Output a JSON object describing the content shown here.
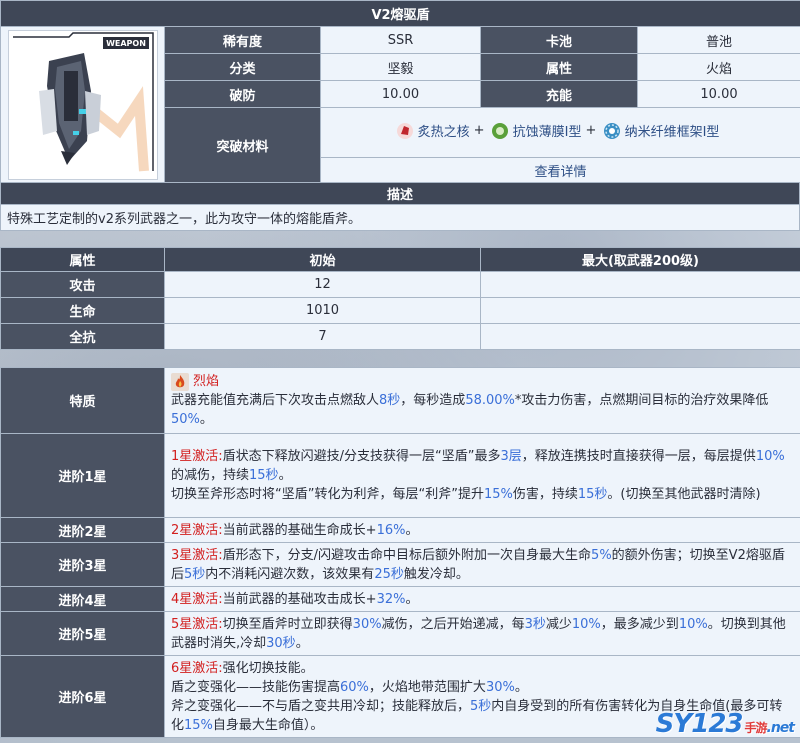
{
  "weapon": {
    "title": "V2熔驱盾",
    "badge": "WEAPON",
    "rarity_label": "稀有度",
    "rarity": "SSR",
    "pool_label": "卡池",
    "pool": "普池",
    "class_label": "分类",
    "class": "坚毅",
    "attr_label": "属性",
    "attr": "火焰",
    "break_label": "破防",
    "break": "10.00",
    "charge_label": "充能",
    "charge": "10.00",
    "breakthrough_label": "突破材料",
    "materials": [
      {
        "name": "炙热之核",
        "sep": "+",
        "icon": "red-crystal-icon",
        "color": "#c0262d"
      },
      {
        "name": "抗蚀薄膜Ⅰ型",
        "sep": "+",
        "icon": "green-film-icon",
        "color": "#5aa03a"
      },
      {
        "name": "纳米纤维框架Ⅰ型",
        "sep": "",
        "icon": "blue-frame-icon",
        "color": "#3a8fc4"
      }
    ],
    "details_link": "查看详情"
  },
  "description": {
    "header": "描述",
    "text": "特殊工艺定制的v2系列武器之一，此为攻守一体的熔能盾斧。"
  },
  "stats": {
    "headers": [
      "属性",
      "初始",
      "最大(取武器200级)"
    ],
    "rows": [
      {
        "label": "攻击",
        "init": "12",
        "max": ""
      },
      {
        "label": "生命",
        "init": "1010",
        "max": ""
      },
      {
        "label": "全抗",
        "init": "7",
        "max": ""
      }
    ]
  },
  "trait": {
    "label": "特质",
    "name": "烈焰",
    "icon": "flame-icon",
    "p1": "武器充能值充满后下次攻击点燃敌人",
    "sec": "8秒",
    "p2": "，每秒造成",
    "pct": "58.00%",
    "p3": "*攻击力伤害，点燃期间目标的治疗效果降低",
    "heal": "50%",
    "p4": "。"
  },
  "advance": [
    {
      "label": "进阶1星",
      "lines": [
        [
          {
            "t": "1星激活:",
            "c": "red"
          },
          {
            "t": "盾状态下释放闪避技/分支技获得一层“坚盾”最多"
          },
          {
            "t": "3层",
            "c": "blue"
          },
          {
            "t": "，释放连携技时直接获得一层，每层提供"
          },
          {
            "t": "10%",
            "c": "blue"
          },
          {
            "t": "的减伤，持续"
          },
          {
            "t": "15秒",
            "c": "blue"
          },
          {
            "t": "。"
          }
        ],
        [
          {
            "t": "切换至斧形态时将“坚盾”转化为利斧，每层“利斧”提升"
          },
          {
            "t": "15%",
            "c": "blue"
          },
          {
            "t": "伤害，持续"
          },
          {
            "t": "15秒",
            "c": "blue"
          },
          {
            "t": "。(切换至其他武器时清除)"
          }
        ]
      ]
    },
    {
      "label": "进阶2星",
      "lines": [
        [
          {
            "t": "2星激活:",
            "c": "red"
          },
          {
            "t": "当前武器的基础生命成长+"
          },
          {
            "t": "16%",
            "c": "blue"
          },
          {
            "t": "。"
          }
        ]
      ]
    },
    {
      "label": "进阶3星",
      "lines": [
        [
          {
            "t": "3星激活:",
            "c": "red"
          },
          {
            "t": "盾形态下，分支/闪避攻击命中目标后额外附加一次自身最大生命"
          },
          {
            "t": "5%",
            "c": "blue"
          },
          {
            "t": "的额外伤害；切换至V2熔驱盾后"
          },
          {
            "t": "5秒",
            "c": "blue"
          },
          {
            "t": "内不消耗闪避次数，该效果有"
          },
          {
            "t": "25秒",
            "c": "blue"
          },
          {
            "t": "触发冷却。"
          }
        ]
      ]
    },
    {
      "label": "进阶4星",
      "lines": [
        [
          {
            "t": "4星激活:",
            "c": "red"
          },
          {
            "t": "当前武器的基础攻击成长+"
          },
          {
            "t": "32%",
            "c": "blue"
          },
          {
            "t": "。"
          }
        ]
      ]
    },
    {
      "label": "进阶5星",
      "lines": [
        [
          {
            "t": "5星激活:",
            "c": "red"
          },
          {
            "t": "切换至盾斧时立即获得"
          },
          {
            "t": "30%",
            "c": "blue"
          },
          {
            "t": "减伤，之后开始递减，每"
          },
          {
            "t": "3秒",
            "c": "blue"
          },
          {
            "t": "减少"
          },
          {
            "t": "10%",
            "c": "blue"
          },
          {
            "t": "，最多减少到"
          },
          {
            "t": "10%",
            "c": "blue"
          },
          {
            "t": "。切换到其他武器时消失,冷却"
          },
          {
            "t": "30秒",
            "c": "blue"
          },
          {
            "t": "。"
          }
        ]
      ]
    },
    {
      "label": "进阶6星",
      "lines": [
        [
          {
            "t": "6星激活:",
            "c": "red"
          },
          {
            "t": "强化切换技能。"
          }
        ],
        [
          {
            "t": "盾之变强化——技能伤害提高"
          },
          {
            "t": "60%",
            "c": "blue"
          },
          {
            "t": "，火焰地带范围扩大"
          },
          {
            "t": "30%",
            "c": "blue"
          },
          {
            "t": "。"
          }
        ],
        [
          {
            "t": "斧之变强化——不与盾之变共用冷却；技能释放后，"
          },
          {
            "t": "5秒",
            "c": "blue"
          },
          {
            "t": "内自身受到的所有伤害转化为自身生命值(最多可转化"
          },
          {
            "t": "15%",
            "c": "blue"
          },
          {
            "t": "自身最大生命值）。"
          }
        ]
      ]
    }
  ],
  "watermark": {
    "brand": "SY123",
    "sub": "手游",
    "domain": ".net"
  }
}
